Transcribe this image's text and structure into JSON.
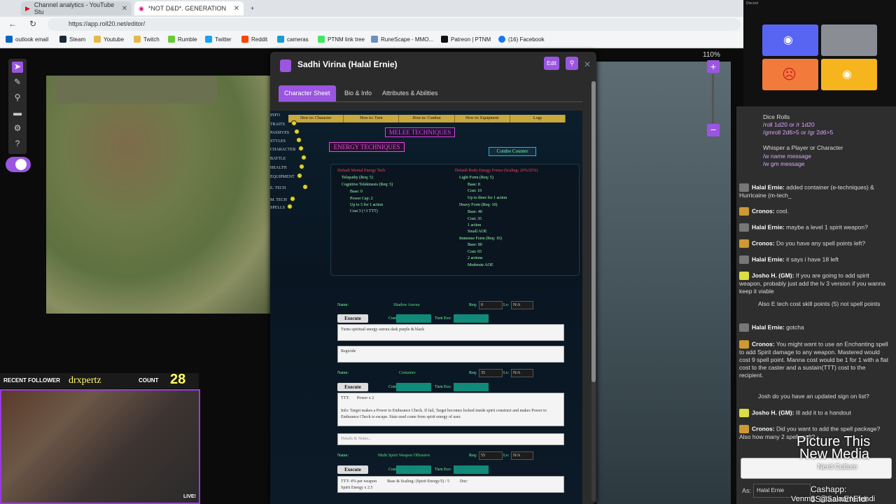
{
  "browser": {
    "tabs": [
      {
        "label": "Channel analytics - YouTube Stu"
      },
      {
        "label": "*NOT D&D*. GENERATION"
      }
    ],
    "url": "https://app.roll20.net/editor/",
    "bookmarks": [
      "outlook email",
      "Steam",
      "Youtube",
      "Twitch",
      "Rumble",
      "Twitter",
      "Reddit",
      "cameras",
      "PTNM link tree",
      "RuneScape - MMO...",
      "Patreon | PTNM",
      "(16) Facebook"
    ]
  },
  "canvas": {
    "zoom": "110%"
  },
  "dialog": {
    "title": "Sadhi Virina (Halal Ernie)",
    "edit_label": "Edit",
    "tabs": [
      "Character Sheet",
      "Bio & Info",
      "Attributes & Abilities"
    ],
    "nav": [
      "How to: Character",
      "How to: Turn",
      "How to: Combat",
      "How to: Equipment",
      "Logs"
    ],
    "side_labels": [
      "INFO",
      "TRAITS",
      "PASSIVES",
      "STYLES",
      "CHARACTER",
      "BATTLE",
      "HEALTH",
      "EQUIPMENT",
      "E. TECH",
      "M. TECH",
      "SPELLS"
    ],
    "melee_heading": "MELEE TECHNIQUES",
    "energy_heading": "ENERGY TECHNIQUES",
    "combo_label": "Combo Counter",
    "mental": {
      "title": "Default Mental Energy Tech",
      "lines": [
        "Telepathy (Req: 5)",
        "Cognitive Telekinesis (Req: 5)",
        "Base: 0",
        "Power Cap: 2",
        "Up to 5 for 1 action",
        "Cost 3 (+3 TTT)"
      ]
    },
    "body": {
      "title": "Default Body Energy Forms (Scaling: 20%/25%)",
      "lines": [
        "Light Form (Req: 5)",
        "Base: 8",
        "Cost: 10",
        "Up to three for 1 action",
        "Heavy Form (Req: 10)",
        "Base: 40",
        "Cost: 35",
        "1 action",
        "Small AOE",
        "Immense Form (Req: 16)",
        "Base: 80",
        "Cost: 65",
        "2 actions",
        "Moderate AOE"
      ]
    },
    "techniques": [
      {
        "name_label": "Name:",
        "name": "Shadow Aurora",
        "req_label": "Req:",
        "req": "0",
        "lv_label": "Lv:",
        "lv": "N/A",
        "exec": "Execute",
        "cost": "Cost",
        "turn": "Turn Eco:",
        "desc": "Turns spiritual energy aurora dark purple & black",
        "notes": "Regicide"
      },
      {
        "name_label": "Name:",
        "name": "Container",
        "req_label": "Req:",
        "req": "35",
        "lv_label": "Lv:",
        "lv": "N/A",
        "exec": "Execute",
        "cost": "Cost",
        "turn": "Turn Eco:",
        "desc": "TTT:       Power x 2\n\nInfo: Target makes a Power to Endurance Check. If fail, Target becomes locked inside spirit construct and makes Power to Endurance Check to escape. Stats used come from spirit energy of user.",
        "notes": "Details & Notes..."
      },
      {
        "name_label": "Name:",
        "name": "Multi Spirit Weapon Offensive",
        "req_label": "Req:",
        "req": "55",
        "lv_label": "Lv:",
        "lv": "N/A",
        "exec": "Execute",
        "cost": "Cost",
        "turn": "Turn Eco:",
        "desc": "TTT: 4% per weapon          Base & Scaling: (Spirit Energy/5) / 5          Dur:\nSpirit Energy x 2.5",
        "notes": ""
      }
    ]
  },
  "stream": {
    "follower_label": "RECENT FOLLOWER",
    "follower_name": "drxpertz",
    "count_label": "COUNT",
    "count_value": "28",
    "live": "LIVE!"
  },
  "discord": {
    "label": "Discord"
  },
  "chat": {
    "help": {
      "dice_title": "Dice Rolls",
      "dice_cmd1": "/roll 1d20 or /r 1d20",
      "dice_cmd2": "/gmroll 2d6>5 or /gr 2d6>5",
      "whisper_title": "Whisper a Player or Character",
      "whisper_cmd1": "/w name message",
      "whisper_cmd2": "/w gm message"
    },
    "messages": [
      {
        "who": "Halal Ernie:",
        "text": "added container (e-techniques) & Hurricaine (m-tech_"
      },
      {
        "who": "Cronos:",
        "text": "cool."
      },
      {
        "who": "Halal Ernie:",
        "text": "maybe a level 1 spirit weapon?"
      },
      {
        "who": "Cronos:",
        "text": "Do you have any spell points left?"
      },
      {
        "who": "Halal Ernie:",
        "text": "it says i have 18 left"
      },
      {
        "who": "Josho H. (GM):",
        "text": "If you are going to add spirit weapon, probably just add the lv 3 version if you wanna keep it viable"
      },
      {
        "who": "",
        "text": "Also E tech cost skill points (5) not spell points"
      },
      {
        "who": "Halal Ernie:",
        "text": "gotcha"
      },
      {
        "who": "Cronos:",
        "text": "You might want to use an Enchanting spell to add Spirit damage to any weapon. Mastered would cost 9 spell point. Manna cost would be 1 for 1 with a flat cost to the caster and a sustain(TTT) cost to the recipient."
      },
      {
        "who": "",
        "text": "Josh do you have an updated sign on list?"
      },
      {
        "who": "Josho H. (GM):",
        "text": "Ill add it to a handout"
      },
      {
        "who": "Cronos:",
        "text": "Did you want to add the spell package? Also how many 2 spell craft?"
      }
    ],
    "as_label": "As:",
    "as_value": "Halal Ernie"
  },
  "watermark": {
    "line1": "Picture This",
    "line2": "New Media",
    "line3": "Nerd Culture",
    "cashapp": "Cashapp: $SalaamEfendi",
    "venmo": "Venmo: @SalaamEfendi"
  }
}
